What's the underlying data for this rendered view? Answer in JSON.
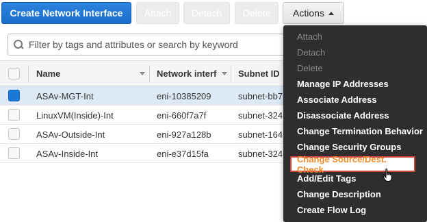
{
  "toolbar": {
    "create_label": "Create Network Interface",
    "attach_label": "Attach",
    "detach_label": "Detach",
    "delete_label": "Delete",
    "actions_label": "Actions"
  },
  "filter": {
    "placeholder": "Filter by tags and attributes or search by keyword"
  },
  "table": {
    "columns": [
      "Name",
      "Network interf",
      "Subnet ID"
    ],
    "rows": [
      {
        "name": "ASAv-MGT-Int",
        "eni": "eni-10385209",
        "subnet": "subnet-bb7",
        "selected": true
      },
      {
        "name": "LinuxVM(Inside)-Int",
        "eni": "eni-660f7a7f",
        "subnet": "subnet-324",
        "selected": false
      },
      {
        "name": "ASAv-Outside-Int",
        "eni": "eni-927a128b",
        "subnet": "subnet-164",
        "selected": false
      },
      {
        "name": "ASAv-Inside-Int",
        "eni": "eni-e37d15fa",
        "subnet": "subnet-324",
        "selected": false
      }
    ]
  },
  "actions_menu": {
    "items": [
      {
        "label": "Attach",
        "disabled": true
      },
      {
        "label": "Detach",
        "disabled": true
      },
      {
        "label": "Delete",
        "disabled": true
      },
      {
        "label": "Manage IP Addresses",
        "disabled": false
      },
      {
        "label": "Associate Address",
        "disabled": false
      },
      {
        "label": "Disassociate Address",
        "disabled": false
      },
      {
        "label": "Change Termination Behavior",
        "disabled": false
      },
      {
        "label": "Change Security Groups",
        "disabled": false
      },
      {
        "label": "Change Source/Dest. Check",
        "disabled": false,
        "highlighted": true
      },
      {
        "label": "Add/Edit Tags",
        "disabled": false
      },
      {
        "label": "Change Description",
        "disabled": false
      },
      {
        "label": "Create Flow Log",
        "disabled": false
      }
    ]
  },
  "colors": {
    "primary": "#1a6dcb",
    "highlight_text": "#f08a28",
    "highlight_border": "#d0443a",
    "menu_bg": "#2e2e2e"
  }
}
